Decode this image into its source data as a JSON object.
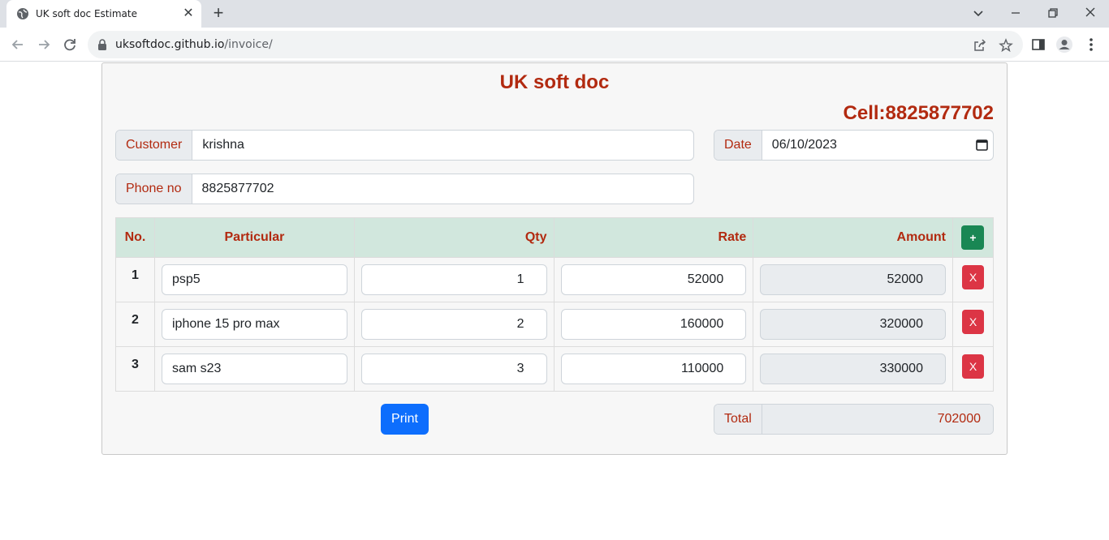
{
  "browser": {
    "tab_title": "UK soft doc Estimate",
    "url_host": "uksoftdoc.github.io",
    "url_path": "/invoice/"
  },
  "header": {
    "brand": "UK soft doc",
    "cell": "Cell:8825877702"
  },
  "form": {
    "customer_label": "Customer",
    "customer_value": "krishna",
    "date_label": "Date",
    "date_value": "06/10/2023",
    "phone_label": "Phone no",
    "phone_value": "8825877702"
  },
  "table": {
    "headers": {
      "no": "No.",
      "particular": "Particular",
      "qty": "Qty",
      "rate": "Rate",
      "amount": "Amount",
      "add": "+"
    },
    "delete_label": "X",
    "rows": [
      {
        "no": "1",
        "particular": "psp5",
        "qty": "1",
        "rate": "52000",
        "amount": "52000"
      },
      {
        "no": "2",
        "particular": "iphone 15 pro max",
        "qty": "2",
        "rate": "160000",
        "amount": "320000"
      },
      {
        "no": "3",
        "particular": "sam s23",
        "qty": "3",
        "rate": "110000",
        "amount": "330000"
      }
    ]
  },
  "footer": {
    "print_label": "Print",
    "total_label": "Total",
    "total_value": "702000"
  },
  "colors": {
    "accent": "#b22a10",
    "header_bg": "#d1e7dd",
    "add_button": "#198754",
    "delete_button": "#dc3545",
    "print_button": "#0d6efd"
  }
}
